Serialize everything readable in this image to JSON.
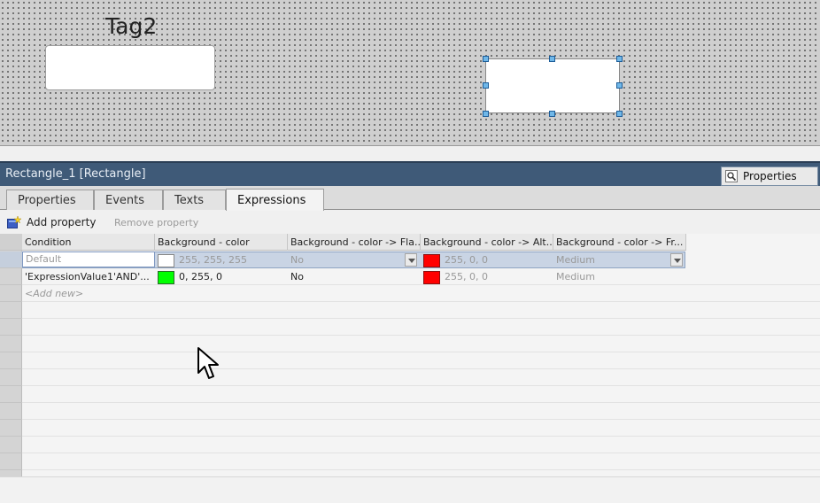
{
  "canvas": {
    "tag_label": "Tag2"
  },
  "panel": {
    "title": "Rectangle_1 [Rectangle]",
    "properties_tab": "Properties",
    "properties_tab_icon": "magnifier-icon"
  },
  "tabs": [
    {
      "label": "Properties",
      "active": false
    },
    {
      "label": "Events",
      "active": false
    },
    {
      "label": "Texts",
      "active": false
    },
    {
      "label": "Expressions",
      "active": true
    }
  ],
  "toolbar": {
    "add_label": "Add property",
    "add_icon": "add-property-icon",
    "remove_label": "Remove property"
  },
  "grid": {
    "columns": [
      "Condition",
      "Background - color",
      "Background - color -> Fla...",
      "Background - color -> Alt...",
      "Background - color -> Fr..."
    ],
    "rows": [
      {
        "condition": "Default",
        "bg_color": "255, 255, 255",
        "bg_swatch": "#ffffff",
        "flash": "No",
        "alt_color": "255, 0, 0",
        "alt_swatch": "#ff0000",
        "freq": "Medium"
      },
      {
        "condition": "'ExpressionValue1'AND'...",
        "bg_color": "0, 255, 0",
        "bg_swatch": "#00ff00",
        "flash": "No",
        "alt_color": "255, 0, 0",
        "alt_swatch": "#ff0000",
        "freq": "Medium"
      }
    ],
    "add_new": "<Add new>"
  }
}
